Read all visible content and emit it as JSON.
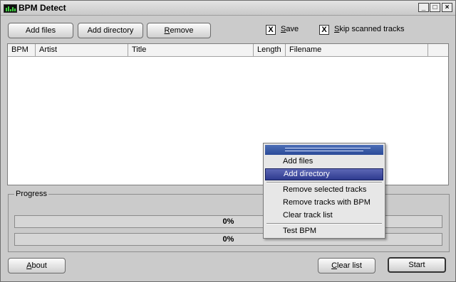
{
  "window": {
    "title": "BPM Detect",
    "icon": "waveform-icon",
    "minimize": "_",
    "maximize": "□",
    "close": "×"
  },
  "toolbar": {
    "add_files": "Add files",
    "add_directory": "Add directory",
    "remove": "Remove"
  },
  "options": {
    "save_label": "Save",
    "save_checked": true,
    "skip_label": "Skip scanned tracks",
    "skip_checked": true,
    "check_mark": "X"
  },
  "list": {
    "columns": [
      "BPM",
      "Artist",
      "Title",
      "Length",
      "Filename"
    ],
    "rows": []
  },
  "progress": {
    "label": "Progress",
    "bar1_text": "0%",
    "bar2_text": "0%",
    "bar1_value": 0,
    "bar2_value": 0
  },
  "context_menu": {
    "items": [
      "Add files",
      "Add directory",
      "Remove selected tracks",
      "Remove tracks with BPM",
      "Clear track list",
      "Test BPM"
    ],
    "selected": "Add directory"
  },
  "footer": {
    "about": "About",
    "clear_list": "Clear list",
    "start": "Start"
  }
}
